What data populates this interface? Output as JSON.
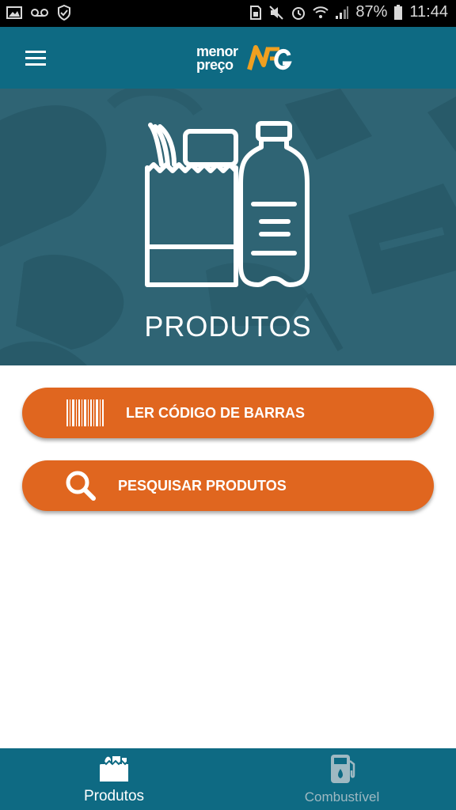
{
  "status_bar": {
    "battery": "87%",
    "time": "11:44"
  },
  "app_bar": {
    "logo_line1": "menor",
    "logo_line2": "preço",
    "logo_brand": "NFG"
  },
  "hero": {
    "title": "PRODUTOS"
  },
  "actions": {
    "barcode_label": "LER CÓDIGO DE BARRAS",
    "search_label": "PESQUISAR PRODUTOS"
  },
  "bottom_nav": {
    "items": [
      {
        "label": "Produtos",
        "active": true
      },
      {
        "label": "Combustível",
        "active": false
      }
    ]
  },
  "colors": {
    "primary": "#0e6a83",
    "hero_bg": "#2f6474",
    "accent": "#e0661f"
  }
}
